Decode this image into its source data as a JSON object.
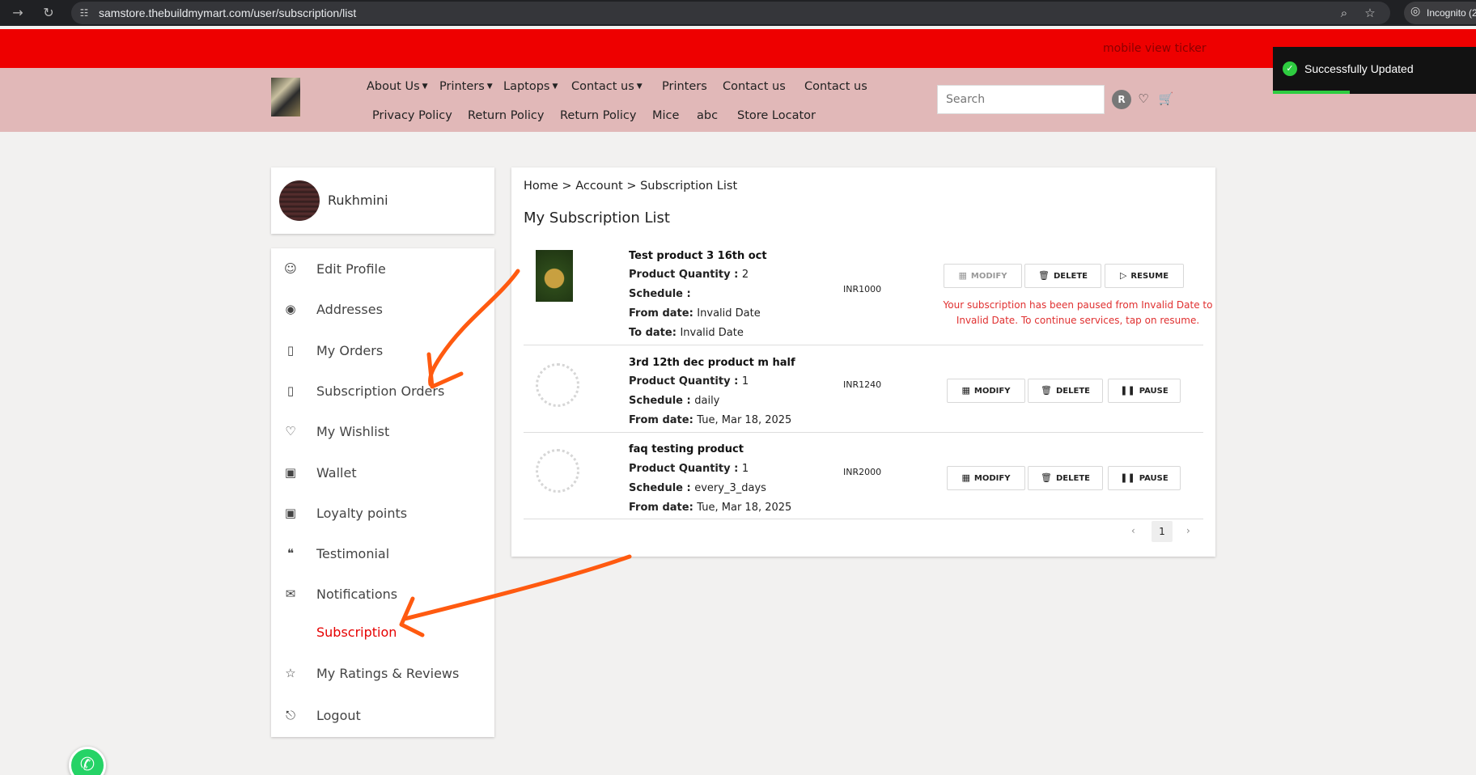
{
  "browser": {
    "url": "samstore.thebuildmymart.com/user/subscription/list",
    "incognito_label": "Incognito (2"
  },
  "ticker": {
    "text": "mobile view ticker"
  },
  "toast": {
    "message": "Successfully Updated"
  },
  "header": {
    "nav_row1": [
      "About Us",
      "Printers",
      "Laptops",
      "Contact us",
      "Printers",
      "Contact us",
      "Contact us"
    ],
    "nav_row2": [
      "Privacy Policy",
      "Return Policy",
      "Return Policy",
      "Mice",
      "abc",
      "Store Locator"
    ],
    "search_placeholder": "Search",
    "avatar_initial": "R"
  },
  "sidebar": {
    "user_name": "Rukhmini",
    "items": [
      {
        "label": "Edit Profile",
        "icon": "user-icon"
      },
      {
        "label": "Addresses",
        "icon": "location-pin-icon"
      },
      {
        "label": "My Orders",
        "icon": "receipt-icon"
      },
      {
        "label": "Subscription Orders",
        "icon": "receipt-icon"
      },
      {
        "label": "My Wishlist",
        "icon": "heart-icon"
      },
      {
        "label": "Wallet",
        "icon": "wallet-icon"
      },
      {
        "label": "Loyalty points",
        "icon": "wallet-icon"
      },
      {
        "label": "Testimonial",
        "icon": "quote-icon"
      },
      {
        "label": "Notifications",
        "icon": "mail-icon"
      },
      {
        "label": "Subscription",
        "icon": ""
      },
      {
        "label": "My Ratings & Reviews",
        "icon": "star-icon"
      },
      {
        "label": "Logout",
        "icon": "logout-icon"
      }
    ]
  },
  "main": {
    "breadcrumb": "Home > Account > Subscription List",
    "title": "My Subscription List",
    "subscriptions": [
      {
        "name": "Test product 3 16th oct",
        "quantity_label": "Product Quantity : ",
        "quantity": "2",
        "schedule_label": "Schedule : ",
        "schedule": "",
        "from_label": "From date: ",
        "from": "Invalid Date",
        "to_label": "To date: ",
        "to": "Invalid Date",
        "price": "INR1000",
        "buttons": [
          "MODIFY",
          "DELETE",
          "RESUME"
        ],
        "message": "Your subscription has been paused from Invalid Date to Invalid Date. To continue services, tap on resume."
      },
      {
        "name": "3rd 12th dec product m half",
        "quantity_label": "Product Quantity : ",
        "quantity": "1",
        "schedule_label": "Schedule : ",
        "schedule": "daily",
        "from_label": "From date: ",
        "from": "Tue, Mar 18, 2025",
        "price": "INR1240",
        "buttons": [
          "MODIFY",
          "DELETE",
          "PAUSE"
        ]
      },
      {
        "name": "faq testing product",
        "quantity_label": "Product Quantity : ",
        "quantity": "1",
        "schedule_label": "Schedule : ",
        "schedule": "every_3_days",
        "from_label": "From date: ",
        "from": "Tue, Mar 18, 2025",
        "price": "INR2000",
        "buttons": [
          "MODIFY",
          "DELETE",
          "PAUSE"
        ]
      }
    ],
    "pagination": {
      "prev": "‹",
      "current": "1",
      "next": "›"
    }
  },
  "colors": {
    "ticker": "#ee0000",
    "header": "#e1b8b8",
    "active": "#e60000",
    "annotation": "#ff5a10"
  }
}
